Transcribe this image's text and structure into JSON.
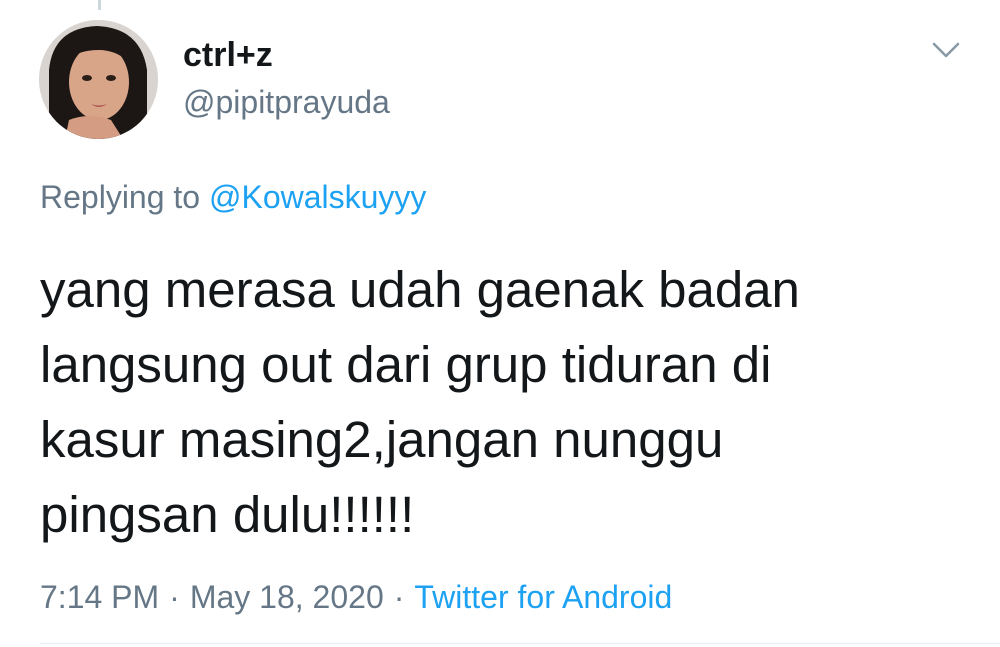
{
  "author": {
    "display_name": "ctrl+z",
    "handle": "@pipitprayuda",
    "avatar_icon": "profile-photo"
  },
  "reply": {
    "prefix": "Replying to",
    "target": "@Kowalskuyyy"
  },
  "tweet": {
    "text": "yang merasa udah gaenak badan\nlangsung out dari grup tiduran di\nkasur masing2,jangan nunggu\npingsan dulu!!!!!!"
  },
  "meta": {
    "time": "7:14 PM",
    "separator": "·",
    "date": "May 18, 2020",
    "source": "Twitter for Android"
  },
  "icons": {
    "menu": "chevron-down-icon"
  },
  "colors": {
    "text": "#14171a",
    "secondary": "#657786",
    "link": "#1da1f2",
    "border": "#e6ecf0"
  }
}
